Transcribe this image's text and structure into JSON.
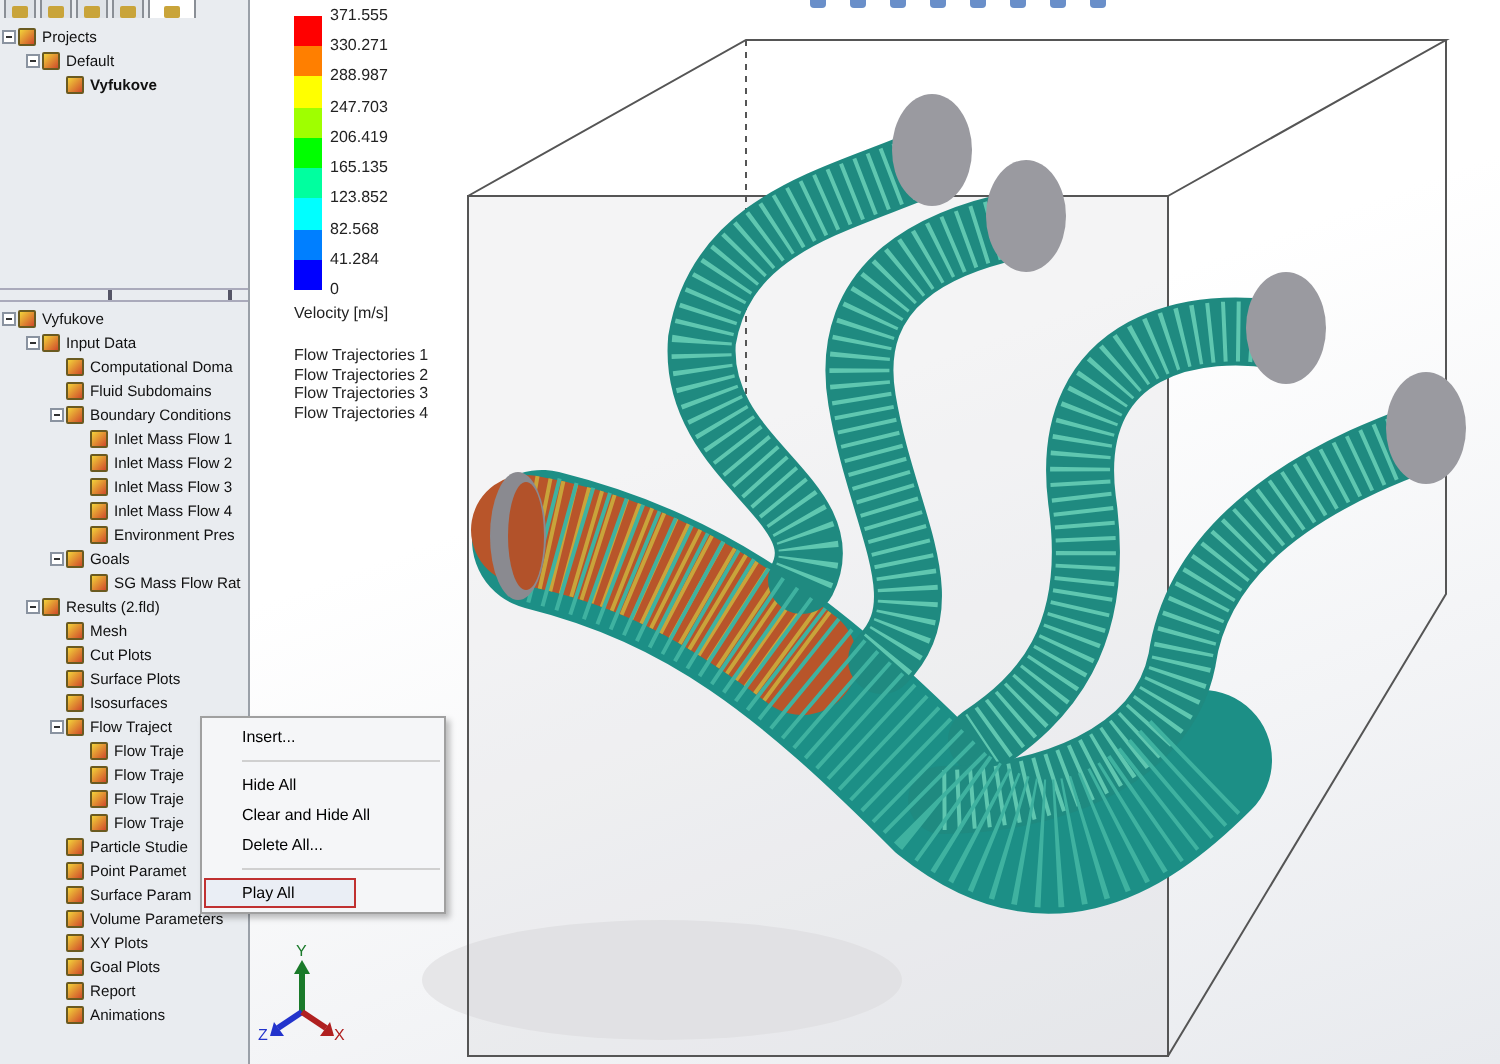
{
  "panel_tabs": [
    {
      "selected": false
    },
    {
      "selected": false
    },
    {
      "selected": false
    },
    {
      "selected": false
    },
    {
      "selected": true
    }
  ],
  "projects_tree": [
    {
      "label": "Projects",
      "expanded": true,
      "active": false,
      "children": [
        {
          "label": "Default",
          "expanded": true,
          "active": false,
          "children": [
            {
              "label": "Vyfukove",
              "active": true
            }
          ]
        }
      ]
    }
  ],
  "analysis_tree": [
    {
      "label": "Vyfukove",
      "expanded": true,
      "children": [
        {
          "label": "Input Data",
          "expanded": true,
          "children": [
            {
              "label": "Computational Doma"
            },
            {
              "label": "Fluid Subdomains"
            },
            {
              "label": "Boundary Conditions",
              "expanded": true,
              "children": [
                {
                  "label": "Inlet Mass Flow 1"
                },
                {
                  "label": "Inlet Mass Flow 2"
                },
                {
                  "label": "Inlet Mass Flow 3"
                },
                {
                  "label": "Inlet Mass Flow 4"
                },
                {
                  "label": "Environment Pres"
                }
              ]
            },
            {
              "label": "Goals",
              "expanded": true,
              "children": [
                {
                  "label": "SG Mass Flow Rat"
                }
              ]
            }
          ]
        },
        {
          "label": "Results (2.fld)",
          "expanded": true,
          "children": [
            {
              "label": "Mesh"
            },
            {
              "label": "Cut Plots"
            },
            {
              "label": "Surface Plots"
            },
            {
              "label": "Isosurfaces"
            },
            {
              "label": "Flow Traject",
              "expanded": true,
              "children": [
                {
                  "label": "Flow Traje"
                },
                {
                  "label": "Flow Traje"
                },
                {
                  "label": "Flow Traje"
                },
                {
                  "label": "Flow Traje"
                }
              ]
            },
            {
              "label": "Particle Studie"
            },
            {
              "label": "Point Paramet"
            },
            {
              "label": "Surface Param"
            },
            {
              "label": "Volume Parameters"
            },
            {
              "label": "XY Plots"
            },
            {
              "label": "Goal Plots"
            },
            {
              "label": "Report"
            },
            {
              "label": "Animations"
            }
          ]
        }
      ]
    }
  ],
  "legend": {
    "bands": [
      {
        "color": "#ff0000"
      },
      {
        "color": "#ff7f00"
      },
      {
        "color": "#ffff00"
      },
      {
        "color": "#9fff00"
      },
      {
        "color": "#00ff00"
      },
      {
        "color": "#00ff9f"
      },
      {
        "color": "#00ffff"
      },
      {
        "color": "#007fff"
      },
      {
        "color": "#0000ff"
      }
    ],
    "ticks": [
      "371.555",
      "330.271",
      "288.987",
      "247.703",
      "206.419",
      "165.135",
      "123.852",
      "82.568",
      "41.284",
      "0"
    ],
    "quantity": "Velocity [m/s]",
    "plots": [
      "Flow Trajectories 1",
      "Flow Trajectories 2",
      "Flow Trajectories 3",
      "Flow Trajectories 4"
    ]
  },
  "context_menu": [
    {
      "kind": "item",
      "label": "Insert...",
      "selected": false
    },
    {
      "kind": "separator"
    },
    {
      "kind": "item",
      "label": "Hide All",
      "selected": false
    },
    {
      "kind": "item",
      "label": "Clear and Hide All",
      "selected": false
    },
    {
      "kind": "item",
      "label": "Delete All...",
      "selected": false
    },
    {
      "kind": "separator"
    },
    {
      "kind": "item",
      "label": "Play All",
      "selected": true
    }
  ],
  "triad": {
    "x": "X",
    "y": "Y",
    "z": "Z"
  }
}
